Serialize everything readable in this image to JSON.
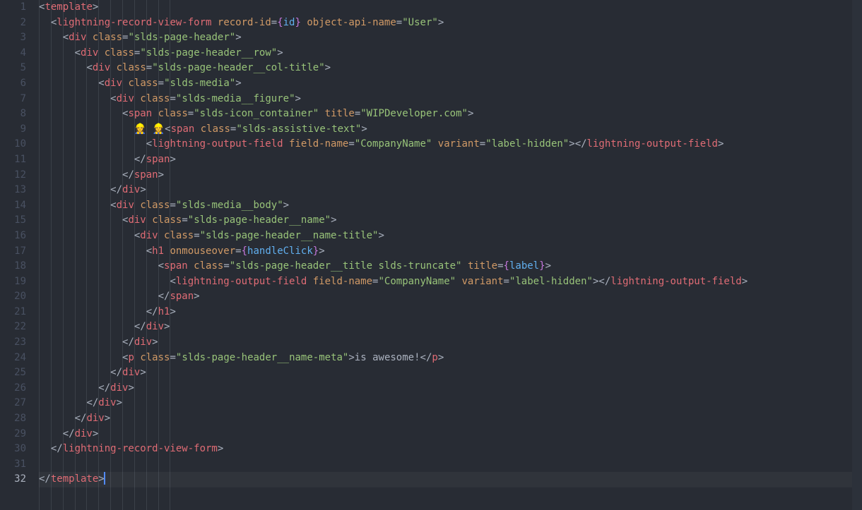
{
  "editor": {
    "active_line": 32,
    "minimap": true
  },
  "lines": [
    {
      "n": 1,
      "indent": 0,
      "tokens": [
        [
          "pun",
          "<"
        ],
        [
          "tag",
          "template"
        ],
        [
          "pun",
          ">"
        ]
      ]
    },
    {
      "n": 2,
      "indent": 1,
      "tokens": [
        [
          "pun",
          "<"
        ],
        [
          "tag",
          "lightning-record-view-form"
        ],
        [
          "txt",
          " "
        ],
        [
          "attr",
          "record-id"
        ],
        [
          "pun",
          "="
        ],
        [
          "brace",
          "{"
        ],
        [
          "ident",
          "id"
        ],
        [
          "brace",
          "}"
        ],
        [
          "txt",
          " "
        ],
        [
          "attr",
          "object-api-name"
        ],
        [
          "pun",
          "="
        ],
        [
          "str",
          "\"User\""
        ],
        [
          "pun",
          ">"
        ]
      ]
    },
    {
      "n": 3,
      "indent": 2,
      "tokens": [
        [
          "pun",
          "<"
        ],
        [
          "tag",
          "div"
        ],
        [
          "txt",
          " "
        ],
        [
          "attr",
          "class"
        ],
        [
          "pun",
          "="
        ],
        [
          "str",
          "\"slds-page-header\""
        ],
        [
          "pun",
          ">"
        ]
      ]
    },
    {
      "n": 4,
      "indent": 3,
      "tokens": [
        [
          "pun",
          "<"
        ],
        [
          "tag",
          "div"
        ],
        [
          "txt",
          " "
        ],
        [
          "attr",
          "class"
        ],
        [
          "pun",
          "="
        ],
        [
          "str",
          "\"slds-page-header__row\""
        ],
        [
          "pun",
          ">"
        ]
      ]
    },
    {
      "n": 5,
      "indent": 4,
      "tokens": [
        [
          "pun",
          "<"
        ],
        [
          "tag",
          "div"
        ],
        [
          "txt",
          " "
        ],
        [
          "attr",
          "class"
        ],
        [
          "pun",
          "="
        ],
        [
          "str",
          "\"slds-page-header__col-title\""
        ],
        [
          "pun",
          ">"
        ]
      ]
    },
    {
      "n": 6,
      "indent": 5,
      "tokens": [
        [
          "pun",
          "<"
        ],
        [
          "tag",
          "div"
        ],
        [
          "txt",
          " "
        ],
        [
          "attr",
          "class"
        ],
        [
          "pun",
          "="
        ],
        [
          "str",
          "\"slds-media\""
        ],
        [
          "pun",
          ">"
        ]
      ]
    },
    {
      "n": 7,
      "indent": 6,
      "tokens": [
        [
          "pun",
          "<"
        ],
        [
          "tag",
          "div"
        ],
        [
          "txt",
          " "
        ],
        [
          "attr",
          "class"
        ],
        [
          "pun",
          "="
        ],
        [
          "str",
          "\"slds-media__figure\""
        ],
        [
          "pun",
          ">"
        ]
      ]
    },
    {
      "n": 8,
      "indent": 7,
      "tokens": [
        [
          "pun",
          "<"
        ],
        [
          "tag",
          "span"
        ],
        [
          "txt",
          " "
        ],
        [
          "attr",
          "class"
        ],
        [
          "pun",
          "="
        ],
        [
          "str",
          "\"slds-icon_container\""
        ],
        [
          "txt",
          " "
        ],
        [
          "attr",
          "title"
        ],
        [
          "pun",
          "="
        ],
        [
          "str",
          "\"WIPDeveloper.com\""
        ],
        [
          "pun",
          ">"
        ]
      ]
    },
    {
      "n": 9,
      "indent": 8,
      "tokens": [
        [
          "emoji",
          "👷‍♀️ 👷‍♀️"
        ],
        [
          "pun",
          "<"
        ],
        [
          "tag",
          "span"
        ],
        [
          "txt",
          " "
        ],
        [
          "attr",
          "class"
        ],
        [
          "pun",
          "="
        ],
        [
          "str",
          "\"slds-assistive-text\""
        ],
        [
          "pun",
          ">"
        ]
      ]
    },
    {
      "n": 10,
      "indent": 9,
      "tokens": [
        [
          "pun",
          "<"
        ],
        [
          "tag",
          "lightning-output-field"
        ],
        [
          "txt",
          " "
        ],
        [
          "attr",
          "field-name"
        ],
        [
          "pun",
          "="
        ],
        [
          "str",
          "\"CompanyName\""
        ],
        [
          "txt",
          " "
        ],
        [
          "attr",
          "variant"
        ],
        [
          "pun",
          "="
        ],
        [
          "str",
          "\"label-hidden\""
        ],
        [
          "pun",
          ">"
        ],
        [
          "pun",
          "</"
        ],
        [
          "tag",
          "lightning-output-field"
        ],
        [
          "pun",
          ">"
        ]
      ]
    },
    {
      "n": 11,
      "indent": 8,
      "tokens": [
        [
          "pun",
          "</"
        ],
        [
          "tag",
          "span"
        ],
        [
          "pun",
          ">"
        ]
      ]
    },
    {
      "n": 12,
      "indent": 7,
      "tokens": [
        [
          "pun",
          "</"
        ],
        [
          "tag",
          "span"
        ],
        [
          "pun",
          ">"
        ]
      ]
    },
    {
      "n": 13,
      "indent": 6,
      "tokens": [
        [
          "pun",
          "</"
        ],
        [
          "tag",
          "div"
        ],
        [
          "pun",
          ">"
        ]
      ]
    },
    {
      "n": 14,
      "indent": 6,
      "tokens": [
        [
          "pun",
          "<"
        ],
        [
          "tag",
          "div"
        ],
        [
          "txt",
          " "
        ],
        [
          "attr",
          "class"
        ],
        [
          "pun",
          "="
        ],
        [
          "str",
          "\"slds-media__body\""
        ],
        [
          "pun",
          ">"
        ]
      ]
    },
    {
      "n": 15,
      "indent": 7,
      "tokens": [
        [
          "pun",
          "<"
        ],
        [
          "tag",
          "div"
        ],
        [
          "txt",
          " "
        ],
        [
          "attr",
          "class"
        ],
        [
          "pun",
          "="
        ],
        [
          "str",
          "\"slds-page-header__name\""
        ],
        [
          "pun",
          ">"
        ]
      ]
    },
    {
      "n": 16,
      "indent": 8,
      "tokens": [
        [
          "pun",
          "<"
        ],
        [
          "tag",
          "div"
        ],
        [
          "txt",
          " "
        ],
        [
          "attr",
          "class"
        ],
        [
          "pun",
          "="
        ],
        [
          "str",
          "\"slds-page-header__name-title\""
        ],
        [
          "pun",
          ">"
        ]
      ]
    },
    {
      "n": 17,
      "indent": 9,
      "tokens": [
        [
          "pun",
          "<"
        ],
        [
          "tag",
          "h1"
        ],
        [
          "txt",
          " "
        ],
        [
          "attr",
          "onmouseover"
        ],
        [
          "pun",
          "="
        ],
        [
          "brace",
          "{"
        ],
        [
          "ident",
          "handleClick"
        ],
        [
          "brace",
          "}"
        ],
        [
          "pun",
          ">"
        ]
      ]
    },
    {
      "n": 18,
      "indent": 10,
      "tokens": [
        [
          "pun",
          "<"
        ],
        [
          "tag",
          "span"
        ],
        [
          "txt",
          " "
        ],
        [
          "attr",
          "class"
        ],
        [
          "pun",
          "="
        ],
        [
          "str",
          "\"slds-page-header__title slds-truncate\""
        ],
        [
          "txt",
          " "
        ],
        [
          "attr",
          "title"
        ],
        [
          "pun",
          "="
        ],
        [
          "brace",
          "{"
        ],
        [
          "ident",
          "label"
        ],
        [
          "brace",
          "}"
        ],
        [
          "pun",
          ">"
        ]
      ]
    },
    {
      "n": 19,
      "indent": 11,
      "tokens": [
        [
          "pun",
          "<"
        ],
        [
          "tag",
          "lightning-output-field"
        ],
        [
          "txt",
          " "
        ],
        [
          "attr",
          "field-name"
        ],
        [
          "pun",
          "="
        ],
        [
          "str",
          "\"CompanyName\""
        ],
        [
          "txt",
          " "
        ],
        [
          "attr",
          "variant"
        ],
        [
          "pun",
          "="
        ],
        [
          "str",
          "\"label-hidden\""
        ],
        [
          "pun",
          ">"
        ],
        [
          "pun",
          "</"
        ],
        [
          "tag",
          "lightning-output-field"
        ],
        [
          "pun",
          ">"
        ]
      ]
    },
    {
      "n": 20,
      "indent": 10,
      "tokens": [
        [
          "pun",
          "</"
        ],
        [
          "tag",
          "span"
        ],
        [
          "pun",
          ">"
        ]
      ]
    },
    {
      "n": 21,
      "indent": 9,
      "tokens": [
        [
          "pun",
          "</"
        ],
        [
          "tag",
          "h1"
        ],
        [
          "pun",
          ">"
        ]
      ]
    },
    {
      "n": 22,
      "indent": 8,
      "tokens": [
        [
          "pun",
          "</"
        ],
        [
          "tag",
          "div"
        ],
        [
          "pun",
          ">"
        ]
      ]
    },
    {
      "n": 23,
      "indent": 7,
      "tokens": [
        [
          "pun",
          "</"
        ],
        [
          "tag",
          "div"
        ],
        [
          "pun",
          ">"
        ]
      ]
    },
    {
      "n": 24,
      "indent": 7,
      "tokens": [
        [
          "pun",
          "<"
        ],
        [
          "tag",
          "p"
        ],
        [
          "txt",
          " "
        ],
        [
          "attr",
          "class"
        ],
        [
          "pun",
          "="
        ],
        [
          "str",
          "\"slds-page-header__name-meta\""
        ],
        [
          "pun",
          ">"
        ],
        [
          "txt",
          "is awesome!"
        ],
        [
          "pun",
          "</"
        ],
        [
          "tag",
          "p"
        ],
        [
          "pun",
          ">"
        ]
      ]
    },
    {
      "n": 25,
      "indent": 6,
      "tokens": [
        [
          "pun",
          "</"
        ],
        [
          "tag",
          "div"
        ],
        [
          "pun",
          ">"
        ]
      ]
    },
    {
      "n": 26,
      "indent": 5,
      "tokens": [
        [
          "pun",
          "</"
        ],
        [
          "tag",
          "div"
        ],
        [
          "pun",
          ">"
        ]
      ]
    },
    {
      "n": 27,
      "indent": 4,
      "tokens": [
        [
          "pun",
          "</"
        ],
        [
          "tag",
          "div"
        ],
        [
          "pun",
          ">"
        ]
      ]
    },
    {
      "n": 28,
      "indent": 3,
      "tokens": [
        [
          "pun",
          "</"
        ],
        [
          "tag",
          "div"
        ],
        [
          "pun",
          ">"
        ]
      ]
    },
    {
      "n": 29,
      "indent": 2,
      "tokens": [
        [
          "pun",
          "</"
        ],
        [
          "tag",
          "div"
        ],
        [
          "pun",
          ">"
        ]
      ]
    },
    {
      "n": 30,
      "indent": 1,
      "tokens": [
        [
          "pun",
          "</"
        ],
        [
          "tag",
          "lightning-record-view-form"
        ],
        [
          "pun",
          ">"
        ]
      ]
    },
    {
      "n": 31,
      "indent": 0,
      "tokens": []
    },
    {
      "n": 32,
      "indent": 0,
      "tokens": [
        [
          "pun",
          "</"
        ],
        [
          "tag",
          "template"
        ],
        [
          "pun",
          ">"
        ],
        [
          "cursor",
          ""
        ]
      ]
    }
  ],
  "indent_unit": "  ",
  "guide_step_ch": 2,
  "max_guides": 11
}
